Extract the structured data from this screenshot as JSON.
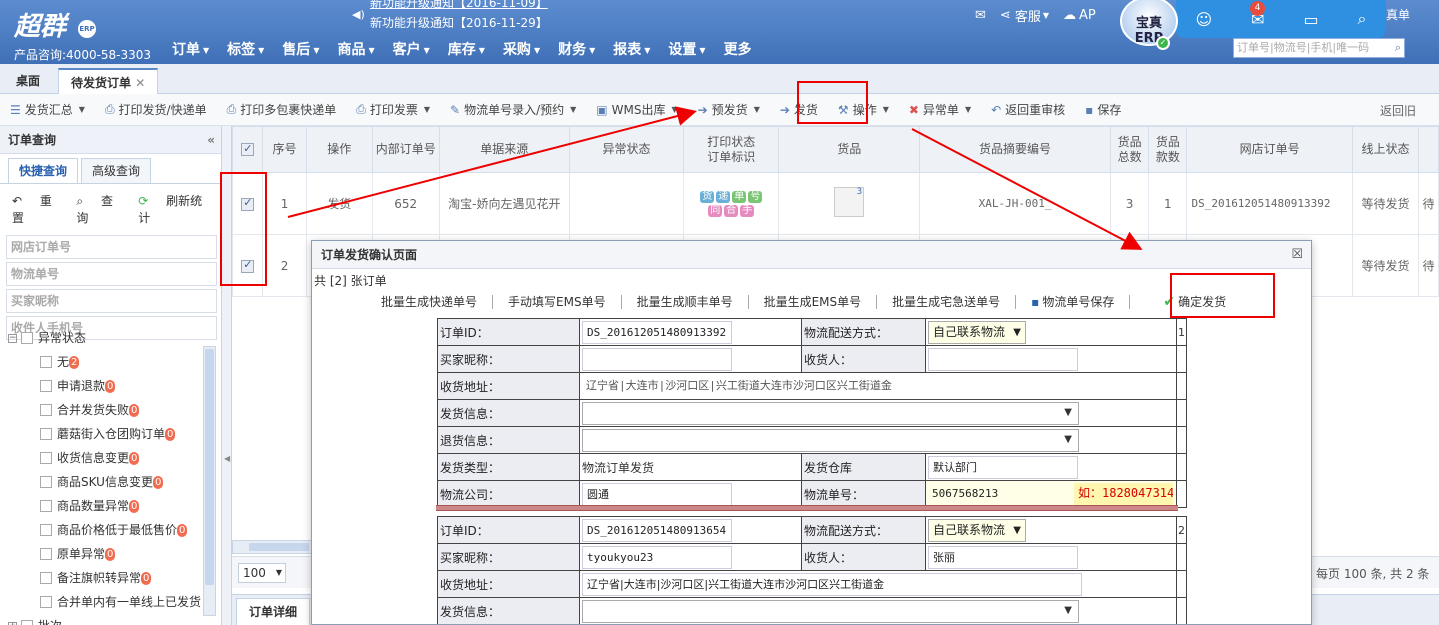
{
  "app": {
    "logo": "超群",
    "logo_badge": "ERP",
    "hotline": "产品咨询:4000-58-3303",
    "notice_line1": "新功能升级通知【2016-11-09】",
    "notice_line2": "新功能升级通知【2016-11-29】",
    "avatar_text": "宝真ERP",
    "mail_badge": "4",
    "top_right_text": "真单",
    "service_label": "客服",
    "api_label": "AP"
  },
  "main_nav": [
    {
      "label": "订单"
    },
    {
      "label": "标签"
    },
    {
      "label": "售后"
    },
    {
      "label": "商品"
    },
    {
      "label": "客户"
    },
    {
      "label": "库存"
    },
    {
      "label": "采购"
    },
    {
      "label": "财务"
    },
    {
      "label": "报表"
    },
    {
      "label": "设置"
    },
    {
      "label": "更多"
    }
  ],
  "top_search": {
    "placeholder": "订单号|物流号|手机|唯一码"
  },
  "page_tabs": {
    "desk": "桌面",
    "active": "待发货订单",
    "close": "✕"
  },
  "toolbar": {
    "summary": "发货汇总",
    "print_express": "打印发货/快递单",
    "print_multi": "打印多包裹快递单",
    "print_invoice": "打印发票",
    "logistics_entry": "物流单号录入/预约",
    "wms": "WMS出库",
    "pre_ship": "预发货",
    "ship": "发货",
    "operate": "操作",
    "exception": "异常单",
    "back_review": "返回重审核",
    "save": "保存",
    "back": "返回旧"
  },
  "sidebar": {
    "title": "订单查询",
    "collapse": "«",
    "tab_quick": "快捷查询",
    "tab_advanced": "高级查询",
    "reset": "重置",
    "query": "查询",
    "refresh": "刷新统计",
    "fields": [
      "网店订单号",
      "物流单号",
      "买家昵称",
      "收件人手机号"
    ],
    "tree_root": "异常状态",
    "tree_items": [
      {
        "label": "无",
        "count": "2"
      },
      {
        "label": "申请退款",
        "count": "0"
      },
      {
        "label": "合并发货失败",
        "count": "0"
      },
      {
        "label": "蘑菇街入仓团购订单",
        "count": "0"
      },
      {
        "label": "收货信息变更",
        "count": "0"
      },
      {
        "label": "商品SKU信息变更",
        "count": "0"
      },
      {
        "label": "商品数量异常",
        "count": "0"
      },
      {
        "label": "商品价格低于最低售价",
        "count": "0"
      },
      {
        "label": "原单异常",
        "count": "0"
      },
      {
        "label": "备注旗帜转异常",
        "count": "0"
      },
      {
        "label": "合并单内有一单线上已发货",
        "count": ""
      }
    ],
    "tree_next": "批次"
  },
  "grid": {
    "headers": [
      "序号",
      "操作",
      "内部订单号",
      "单据来源",
      "异常状态",
      "打印状态\n订单标识",
      "货品",
      "货品摘要编号",
      "货品\n总数",
      "货品\n款数",
      "网店订单号",
      "线上状态"
    ],
    "rows": [
      {
        "seq": "1",
        "op": "发货",
        "inner": "652",
        "source": "淘宝-娇向左遇见花开",
        "abnormal": "",
        "tag1": "货",
        "tag2": "递",
        "tag3": "单",
        "tag4": "号",
        "tag5": "同",
        "tag6": "合",
        "tag7": "手",
        "prod_count": "3",
        "summary": "XAL-JH-001_",
        "total": "3",
        "kinds": "1",
        "shop_order": "DS_201612051480913392",
        "status": "等待发货",
        "extra": "待"
      },
      {
        "seq": "2",
        "op": "",
        "inner": "",
        "source": "",
        "abnormal": "",
        "prod_count": "",
        "summary": "",
        "total": "",
        "kinds": "",
        "shop_order": "",
        "status": "等待发货",
        "extra": "待"
      }
    ],
    "page_size": "100",
    "pager_info": "每页 100 条, 共 2 条",
    "detail_tab": "订单详细"
  },
  "modal": {
    "title": "订单发货确认页面",
    "close": "☒",
    "count_text": "共 [2] 张订单",
    "tools": [
      "批量生成快递单号",
      "手动填写EMS单号",
      "批量生成顺丰单号",
      "批量生成EMS单号",
      "批量生成宅急送单号",
      "物流单号保存",
      "确定发货"
    ],
    "orders": [
      {
        "idx": "1",
        "order_id_label": "订单ID：",
        "order_id": "DS_201612051480913392",
        "method_label": "物流配送方式：",
        "method": "自己联系物流",
        "buyer_label": "买家昵称：",
        "buyer": "",
        "receiver_label": "收货人：",
        "receiver": "",
        "address_label": "收货地址：",
        "address": "辽宁省|大连市|沙河口区|兴工街道大连市沙河口区兴工街道金",
        "ship_info_label": "发货信息：",
        "return_info_label": "退货信息：",
        "type_label": "发货类型：",
        "type": "物流订单发货",
        "warehouse_label": "发货仓库",
        "warehouse": "默认部门",
        "company_label": "物流公司：",
        "company": "圆通",
        "tracking_label": "物流单号：",
        "tracking": "5067568213",
        "tracking_hint": "如：1828047314"
      },
      {
        "idx": "2",
        "order_id_label": "订单ID：",
        "order_id": "DS_201612051480913654",
        "method_label": "物流配送方式：",
        "method": "自己联系物流",
        "buyer_label": "买家昵称：",
        "buyer": "tyoukyou23",
        "receiver_label": "收货人：",
        "receiver": "张丽",
        "address_label": "收货地址：",
        "address": "辽宁省|大连市|沙河口区|兴工街道大连市沙河口区兴工街道金",
        "ship_info_label": "发货信息："
      }
    ]
  },
  "colors": {
    "accent": "#3f6fb6",
    "annotation": "#e00000",
    "online": "#3cb54a"
  }
}
